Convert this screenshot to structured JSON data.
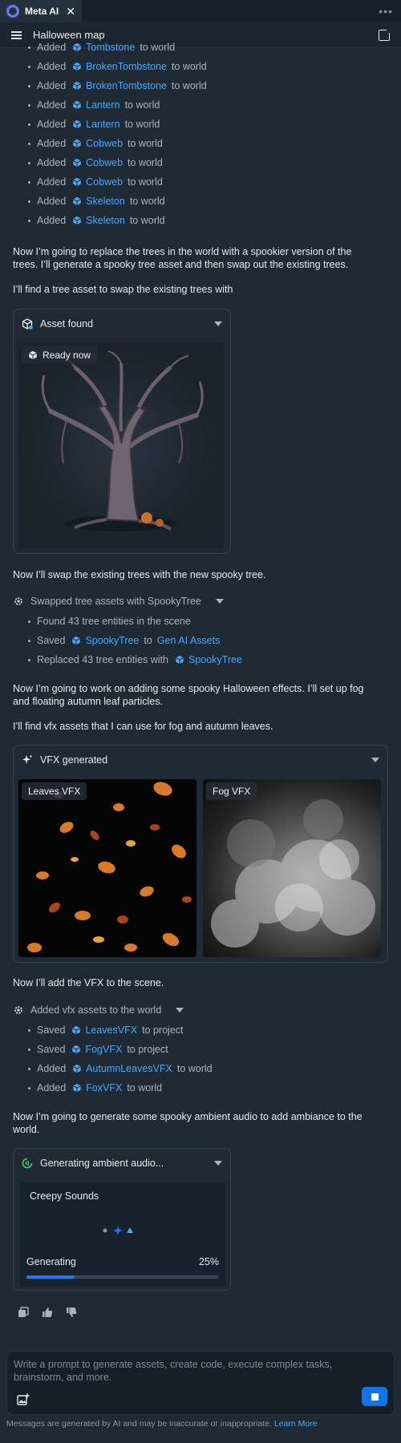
{
  "tab": {
    "label": "Meta AI",
    "close": "✕",
    "more": "•••"
  },
  "header": {
    "title": "Halloween map"
  },
  "world_log": [
    {
      "verb": "Added",
      "asset": "Tombstone",
      "suffix": "to world"
    },
    {
      "verb": "Added",
      "asset": "BrokenTombstone",
      "suffix": "to world"
    },
    {
      "verb": "Added",
      "asset": "BrokenTombstone",
      "suffix": "to world"
    },
    {
      "verb": "Added",
      "asset": "Lantern",
      "suffix": "to world"
    },
    {
      "verb": "Added",
      "asset": "Lantern",
      "suffix": "to world"
    },
    {
      "verb": "Added",
      "asset": "Cobweb",
      "suffix": "to world"
    },
    {
      "verb": "Added",
      "asset": "Cobweb",
      "suffix": "to world"
    },
    {
      "verb": "Added",
      "asset": "Cobweb",
      "suffix": "to world"
    },
    {
      "verb": "Added",
      "asset": "Skeleton",
      "suffix": "to world"
    },
    {
      "verb": "Added",
      "asset": "Skeleton",
      "suffix": "to world"
    }
  ],
  "messages": {
    "trees_plan": "Now I’m going to replace the trees in the world with a spookier version of the trees. I’ll generate a spooky tree asset and then swap out the existing trees.",
    "find_tree": "I’ll find a tree asset to swap the existing trees with",
    "swap_tree": "Now I’ll swap the existing trees with the new spooky tree.",
    "effects_plan": "Now I’m going to work on adding some spooky Halloween effects. I’ll set up fog and floating autumn leaf particles.",
    "find_vfx": "I’ll find vfx assets that I can use for fog and autumn leaves.",
    "add_vfx": "Now I’ll add the VFX to the scene.",
    "audio_plan": "Now I’m going to generate some spooky ambient audio to add ambiance to the world."
  },
  "asset_card": {
    "title": "Asset found",
    "badge": "Ready now"
  },
  "swap_step": {
    "title": "Swapped tree assets with SpookyTree",
    "items": [
      {
        "text": "Found 43 tree entities in the scene"
      },
      {
        "verb": "Saved",
        "asset": "SpookyTree",
        "middle": "to",
        "link": "Gen AI Assets"
      },
      {
        "verb": "Replaced 43 tree entities with",
        "asset": "SpookyTree"
      }
    ]
  },
  "vfx_card": {
    "title": "VFX generated",
    "leaves_label": "Leaves VFX",
    "fog_label": "Fog VFX"
  },
  "vfx_step": {
    "title": "Added vfx assets to the world",
    "items": [
      {
        "verb": "Saved",
        "asset": "LeavesVFX",
        "suffix": "to project"
      },
      {
        "verb": "Saved",
        "asset": "FogVFX",
        "suffix": "to project"
      },
      {
        "verb": "Added",
        "asset": "AutumnLeavesVFX",
        "suffix": "to world"
      },
      {
        "verb": "Added",
        "asset": "FoxVFX",
        "suffix": "to world"
      }
    ]
  },
  "audio_card": {
    "title": "Generating ambient audio...",
    "track": "Creepy Sounds",
    "status": "Generating",
    "percent_label": "25%",
    "progress": 0.25
  },
  "composer": {
    "placeholder": "Write a prompt to generate assets, create code, execute complex tasks, brainstorm, and more."
  },
  "disclaimer": {
    "text": "Messages are generated by AI and may be inaccurate or inappropriate.",
    "link": "Learn More"
  },
  "colors": {
    "accent": "#1473e6",
    "link": "#4ea6f5",
    "background": "#1f2a35"
  }
}
